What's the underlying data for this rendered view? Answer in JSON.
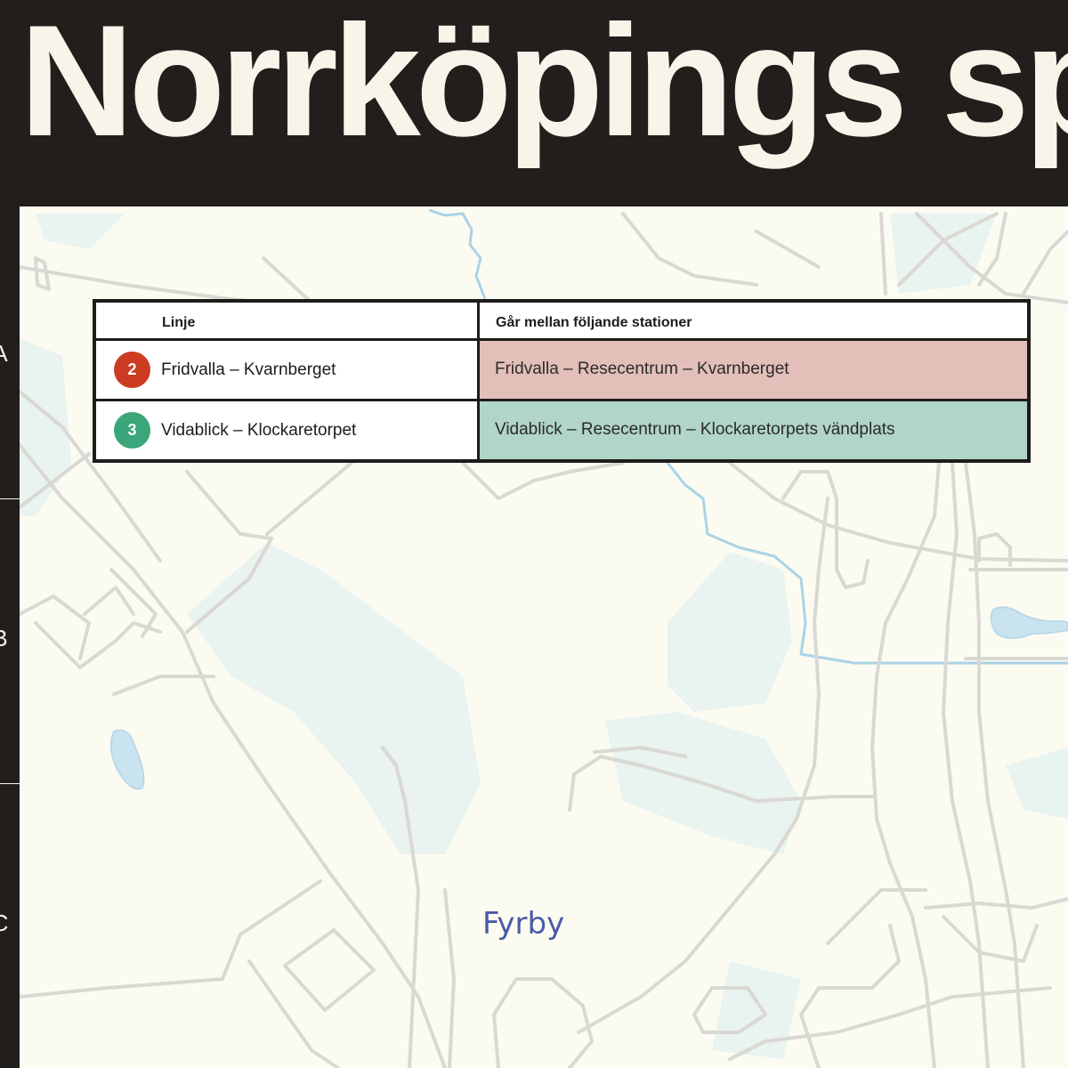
{
  "title": "Norrköpings spå",
  "grid": {
    "rows": [
      "A",
      "B",
      "C"
    ]
  },
  "map": {
    "place_label": "Fyrby",
    "colors": {
      "background": "#fcfbf2",
      "road": "#d9d8d2",
      "water": "#c9e4f0",
      "green": "#e9f3ef"
    }
  },
  "legend": {
    "header_line": "Linje",
    "header_stations": "Går mellan följande stationer",
    "lines": [
      {
        "number": "2",
        "name": "Fridvalla – Kvarnberget",
        "stations": "Fridvalla – Resecentrum – Kvarnberget",
        "color": "#cc3b22",
        "tint": "#e3bfb9"
      },
      {
        "number": "3",
        "name": "Vidablick – Klockaretorpet",
        "stations": "Vidablick – Resecentrum – Klockaretorpets vändplats",
        "color": "#3aa679",
        "tint": "#b1d5c6"
      }
    ]
  }
}
